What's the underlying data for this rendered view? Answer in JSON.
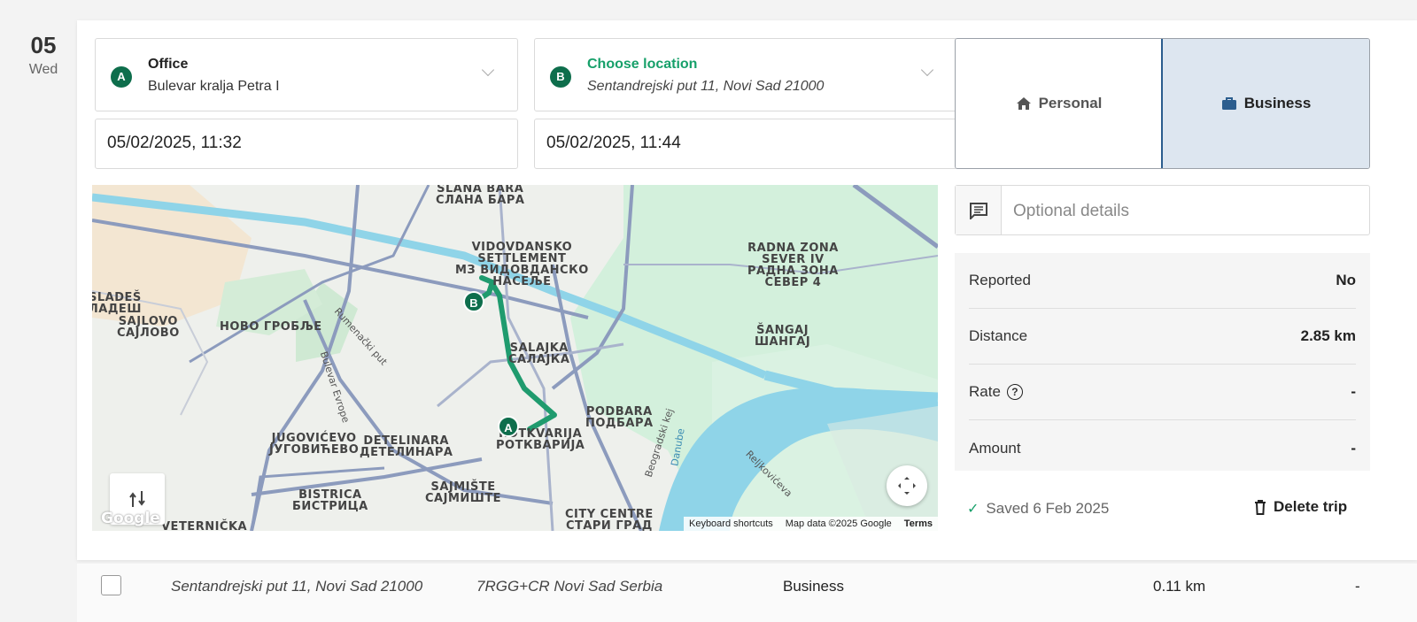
{
  "date": {
    "day": "05",
    "weekday": "Wed"
  },
  "start": {
    "pin": "A",
    "title": "Office",
    "address": "Bulevar kralja Petra I",
    "datetime": "05/02/2025, 11:32"
  },
  "end": {
    "pin": "B",
    "title": "Choose location",
    "address": "Sentandrejski put 11, Novi Sad 21000",
    "datetime": "05/02/2025, 11:44"
  },
  "trip_type": {
    "personal_label": "Personal",
    "business_label": "Business",
    "selected": "Business"
  },
  "details": {
    "placeholder": "Optional details"
  },
  "stats": {
    "reported_label": "Reported",
    "reported_value": "No",
    "distance_label": "Distance",
    "distance_value": "2.85 km",
    "rate_label": "Rate",
    "rate_help": "?",
    "rate_value": "-",
    "amount_label": "Amount",
    "amount_value": "-"
  },
  "footer": {
    "saved_text": "Saved 6 Feb 2025",
    "delete_label": "Delete trip"
  },
  "map": {
    "labels": {
      "slana_bara": "SLANA BARA\nСЛАНА БАРА",
      "vidovdansko": "VIDOVDANSKO\nSETTLEMENT\nМЗ ВИДОВДАНСКО\nНАСЕЉЕ",
      "radna_zona": "RADNA ZONA\nSEVER IV\nРАДНА ЗОНА\nСЕВЕР 4",
      "sladeš": "SLADEŠ\nЛАДЕШ",
      "sajlovo": "SAJLOVO\nСАЈЛОВО",
      "novo_groblje": "НОВО ГРОБЉЕ",
      "sangaj": "ŠANGAJ\nШАНГАЈ",
      "salajka": "SALAJKA\nСАЛАЈКА",
      "podbara": "PODBARA\nПОДБАРА",
      "jugovicevo": "JUGOVIĆEVO\nЈУГОВИЋЕВО",
      "detelinara": "DETELINARA\nДЕТЕЛИНАРА",
      "rotkvarija": "ROTKVARIJA\nРОТКВАРИЈА",
      "bistrica": "BISTRICA\nБИСТРИЦА",
      "sajmiste": "SAJMIŠTE\nСАЈМИШТЕ",
      "city_centre": "CITY CENTRE\nСТАРИ ГРАД",
      "veternicka": "VETERNIČKA",
      "rumenacki": "Rumenački put",
      "bulevar_evrope": "Bulevar Evrope",
      "beogradski_kej": "Beogradski kej",
      "danube": "Danube",
      "reljkoviceva": "Reljkovićeva"
    },
    "pin_a": "A",
    "pin_b": "B",
    "google": "Google",
    "keyboard_shortcuts": "Keyboard shortcuts",
    "map_data": "Map data ©2025 Google",
    "terms": "Terms"
  },
  "next_row": {
    "from": "Sentandrejski put 11, Novi Sad 21000",
    "to": "7RGG+CR Novi Sad Serbia",
    "type": "Business",
    "distance": "0.11 km",
    "amount": "-"
  },
  "colors": {
    "accent": "#0e6e4c",
    "route": "#1f9b6e",
    "business_bg": "#dde6f0",
    "river": "#8fd4e8",
    "park": "#c8ecd6"
  }
}
